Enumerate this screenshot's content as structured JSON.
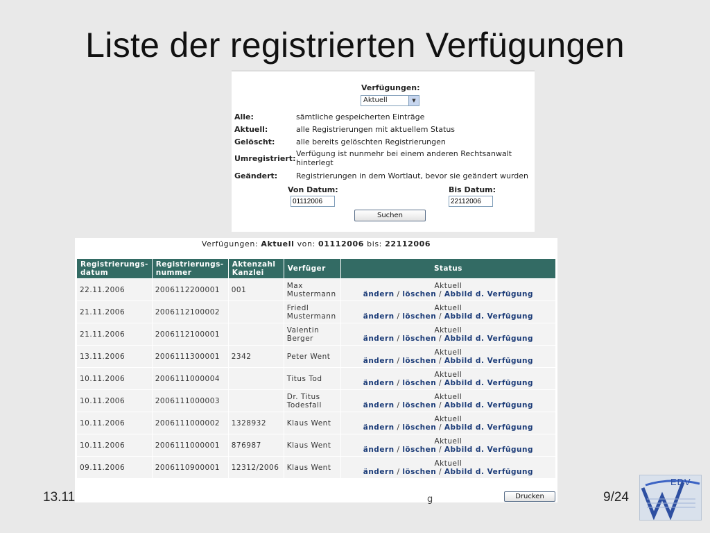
{
  "slide": {
    "title": "Liste der registrierten Verfügungen",
    "footer_left": "13.11",
    "footer_mid": "g",
    "page": "9/24"
  },
  "filter": {
    "label": "Verfügungen:",
    "selected": "Aktuell",
    "definitions": [
      {
        "term": "Alle:",
        "desc": "sämtliche gespeicherten Einträge"
      },
      {
        "term": "Aktuell:",
        "desc": "alle Registrierungen mit aktuellem Status"
      },
      {
        "term": "Gelöscht:",
        "desc": "alle bereits gelöschten Registrierungen"
      },
      {
        "term": "Umregistriert:",
        "desc": "Verfügung ist nunmehr bei einem anderen Rechtsanwalt hinterlegt"
      },
      {
        "term": "Geändert:",
        "desc": "Registrierungen in dem Wortlaut, bevor sie geändert wurden"
      }
    ],
    "von_label": "Von Datum:",
    "von_value": "01112006",
    "bis_label": "Bis Datum:",
    "bis_value": "22112006",
    "search_button": "Suchen"
  },
  "results": {
    "summary_prefix": "Verfügungen: ",
    "summary_status": "Aktuell",
    "summary_von_label": " von: ",
    "summary_von": "01112006",
    "summary_bis_label": " bis: ",
    "summary_bis": "22112006",
    "columns": [
      "Registrierungs-\ndatum",
      "Registrierungs-\nnummer",
      "Aktenzahl\nKanzlei",
      "Verfüger",
      "Status"
    ],
    "action_labels": {
      "change": "ändern",
      "delete": "löschen",
      "image": "Abbild d. Verfügung"
    },
    "rows": [
      {
        "date": "22.11.2006",
        "number": "2006112200001",
        "file": "001",
        "person": "Max Mustermann",
        "status": "Aktuell"
      },
      {
        "date": "21.11.2006",
        "number": "2006112100002",
        "file": "",
        "person": "Friedl Mustermann",
        "status": "Aktuell"
      },
      {
        "date": "21.11.2006",
        "number": "2006112100001",
        "file": "",
        "person": "Valentin Berger",
        "status": "Aktuell"
      },
      {
        "date": "13.11.2006",
        "number": "2006111300001",
        "file": "2342",
        "person": "Peter Went",
        "status": "Aktuell"
      },
      {
        "date": "10.11.2006",
        "number": "2006111000004",
        "file": "",
        "person": "Titus Tod",
        "status": "Aktuell"
      },
      {
        "date": "10.11.2006",
        "number": "2006111000003",
        "file": "",
        "person": "Dr. Titus Todesfall",
        "status": "Aktuell"
      },
      {
        "date": "10.11.2006",
        "number": "2006111000002",
        "file": "1328932",
        "person": "Klaus Went",
        "status": "Aktuell"
      },
      {
        "date": "10.11.2006",
        "number": "2006111000001",
        "file": "876987",
        "person": "Klaus Went",
        "status": "Aktuell"
      },
      {
        "date": "09.11.2006",
        "number": "2006110900001",
        "file": "12312/2006",
        "person": "Klaus Went",
        "status": "Aktuell"
      }
    ],
    "print_button": "Drucken"
  },
  "logo": {
    "text": "EDV",
    "icon": "edv-w-logo-icon",
    "accent": "#2d4fa1"
  }
}
